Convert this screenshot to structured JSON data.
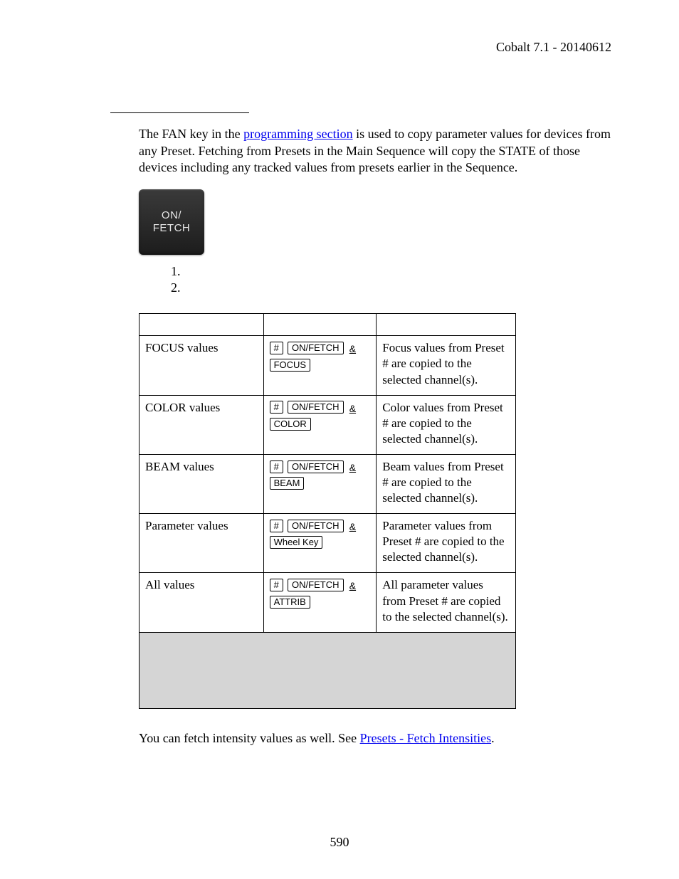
{
  "header": "Cobalt 7.1 - 20140612",
  "intro": {
    "pre": "The FAN key in the ",
    "link": "programming section",
    "post": " is used to copy parameter values for devices from any Preset. Fetching from Presets in the Main Sequence will copy the STATE of those devices including any tracked values from presets earlier in the Sequence."
  },
  "key_button": {
    "line1": "ON/",
    "line2": "FETCH"
  },
  "list": {
    "n1": "1.",
    "n2": "2."
  },
  "keys": {
    "hash": "#",
    "onfetch": "ON/FETCH",
    "amp": "&",
    "focus": "FOCUS",
    "color": "COLOR",
    "beam": "BEAM",
    "wheel": "Wheel Key",
    "attrib": "ATTRIB"
  },
  "rows": [
    {
      "label": "FOCUS values",
      "result": "Focus values from Preset # are copied to the selected channel(s)."
    },
    {
      "label": "COLOR values",
      "result": "Color values from Preset # are copied to the selected channel(s)."
    },
    {
      "label": "BEAM values",
      "result": "Beam values from Preset # are copied to the selected channel(s)."
    },
    {
      "label": "Parameter values",
      "result": "Parameter values from Preset # are copied to the selected channel(s)."
    },
    {
      "label": "All values",
      "result": "All parameter values from Preset # are copied to the selected channel(s)."
    }
  ],
  "note": {
    "pre": "You can fetch intensity values as well. See ",
    "link": "Presets - Fetch Intensities",
    "post": "."
  },
  "page_number": "590"
}
